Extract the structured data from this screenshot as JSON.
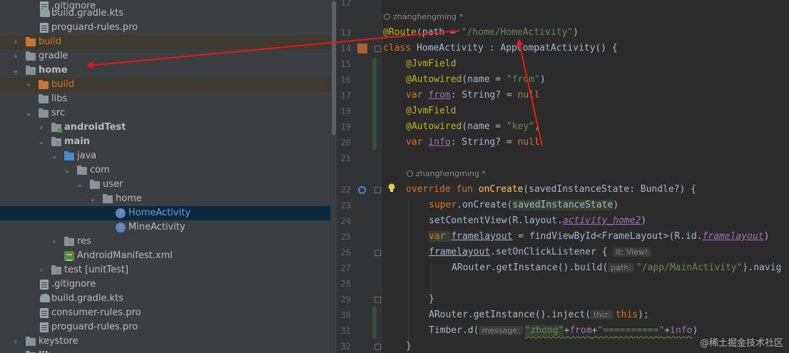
{
  "project_tree": {
    "rows": [
      {
        "label": ".gitignore",
        "type": "file"
      },
      {
        "label": "build.gradle.kts",
        "type": "gradle"
      },
      {
        "label": "proguard-rules.pro",
        "type": "file"
      },
      {
        "label": "build",
        "type": "folder-excluded"
      },
      {
        "label": "gradle",
        "type": "folder"
      },
      {
        "label": "home",
        "type": "module"
      },
      {
        "label": "build",
        "type": "folder-excluded"
      },
      {
        "label": "libs",
        "type": "folder"
      },
      {
        "label": "src",
        "type": "folder"
      },
      {
        "label": "androidTest",
        "type": "source-folder"
      },
      {
        "label": "main",
        "type": "source-folder"
      },
      {
        "label": "java",
        "type": "source-root"
      },
      {
        "label": "com",
        "type": "package"
      },
      {
        "label": "user",
        "type": "package"
      },
      {
        "label": "home",
        "type": "package"
      },
      {
        "label": "HomeActivity",
        "type": "kotlin-class"
      },
      {
        "label": "MineActivity",
        "type": "kotlin-class"
      },
      {
        "label": "res",
        "type": "resources"
      },
      {
        "label": "AndroidManifest.xml",
        "type": "xml"
      },
      {
        "label": "test",
        "suffix": "[unitTest]",
        "type": "test-folder"
      },
      {
        "label": ".gitignore",
        "type": "file"
      },
      {
        "label": "build.gradle.kts",
        "type": "gradle"
      },
      {
        "label": "consumer-rules.pro",
        "type": "file"
      },
      {
        "label": "proguard-rules.pro",
        "type": "file"
      },
      {
        "label": "keystore",
        "type": "folder"
      },
      {
        "label": "lib",
        "type": "folder"
      }
    ]
  },
  "editor": {
    "author": "zhanghengming *",
    "line_numbers": [
      "12",
      "13",
      "14",
      "15",
      "16",
      "17",
      "18",
      "19",
      "20",
      "21",
      "22",
      "23",
      "24",
      "25",
      "26",
      "27",
      "28",
      "29",
      "30",
      "31",
      "32"
    ],
    "code": {
      "l13_ann": "@Route",
      "l13_a": "(path = ",
      "l13_str": "\"/home/HomeActivity\"",
      "l13_b": ")",
      "l14_kw": "class ",
      "l14_a": "HomeActivity : AppCompatActivity() {",
      "jvmfield": "@JvmField",
      "autowired": "@Autowired",
      "l16_a": "(name = ",
      "l16_str": "\"from\"",
      "l16_b": ")",
      "var": "var ",
      "from": "from",
      "l17_a": ": String? = ",
      "null": "null",
      "l19_str": "\"key\"",
      "info": "info",
      "override": "override fun ",
      "oncreate": "onCreate",
      "l22_a": "(savedInstanceState: Bundle?) {",
      "super": "super",
      "l23_a": ".onCreate(",
      "l23_b": "savedInstanceState",
      "l23_c": ")",
      "l24_a": "setContentView(R.layout.",
      "l24_b": "activity_home2",
      "l24_c": ")",
      "framelayout": "framelayout",
      "l25_a": " = findViewById<FrameLayout>(R.id.",
      "l25_b": "framelayout",
      "l25_c": ")",
      "l26_a": ".setOnClickListener { ",
      "l26_hint": "it: View!",
      "l27_a": "ARouter.getInstance().build(",
      "l27_hint": "path:",
      "l27_str": "\"/app/MainActivity\"",
      "l27_b": ").navig",
      "l29": "}",
      "l30_a": "ARouter.getInstance().inject(",
      "l30_hint": "thiz:",
      "l30_kw": "this",
      "l30_b": ");",
      "l31_a": "Timber.d(",
      "l31_hint": "message:",
      "l31_str1": "\"zhong\"",
      "l31_b": "+",
      "l31_from": "from",
      "l31_c": "+",
      "l31_str2": "\"==========\"",
      "l31_d": "+",
      "l31_info": "info",
      "l31_e": ")",
      "l32": "}"
    }
  },
  "watermark": "@稀土掘金技术社区",
  "colors": {
    "arrow": "#e81919",
    "tree_bg": "#3c3f41",
    "editor_bg": "#2b2b2b",
    "selection": "#0d293e"
  }
}
